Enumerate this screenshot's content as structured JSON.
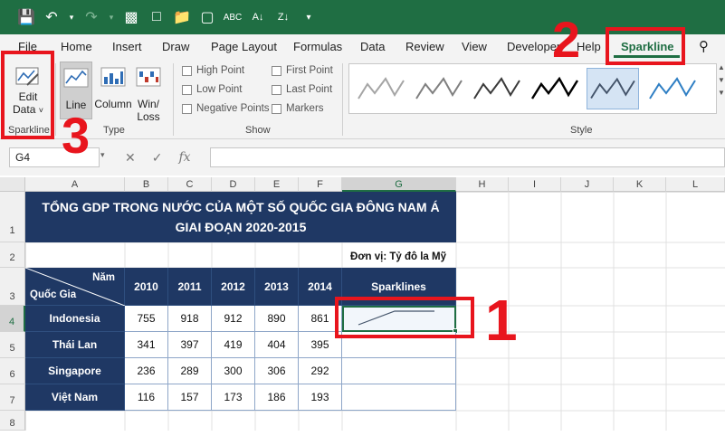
{
  "ribbon_tabs": [
    "File",
    "Home",
    "Insert",
    "Draw",
    "Page Layout",
    "Formulas",
    "Data",
    "Review",
    "View",
    "Developer",
    "Help",
    "Sparkline"
  ],
  "active_tab": "Sparkline",
  "groups": {
    "sparkline": {
      "label": "Sparkline",
      "edit_data": "Edit",
      "edit_data2": "Data"
    },
    "type": {
      "label": "Type",
      "line": "Line",
      "column": "Column",
      "winloss1": "Win/",
      "winloss2": "Loss"
    },
    "show": {
      "label": "Show",
      "items": [
        "High Point",
        "Low Point",
        "Negative Points",
        "First Point",
        "Last Point",
        "Markers"
      ]
    },
    "style": {
      "label": "Style"
    }
  },
  "formula_bar": {
    "name_box": "G4",
    "fx": "fx",
    "formula": ""
  },
  "columns": [
    "A",
    "B",
    "C",
    "D",
    "E",
    "F",
    "G",
    "H",
    "I",
    "J",
    "K",
    "L"
  ],
  "rows": [
    "1",
    "2",
    "3",
    "4",
    "5",
    "6",
    "7",
    "8"
  ],
  "sheet": {
    "title_line1": "TỔNG GDP TRONG NƯỚC CỦA MỘT SỐ QUỐC GIA ĐÔNG NAM Á",
    "title_line2": "GIAI ĐOẠN 2020-2015",
    "unit": "Đơn vị: Tỷ đô la Mỹ",
    "header_year": "Năm",
    "header_country": "Quốc Gia",
    "years": [
      "2010",
      "2011",
      "2012",
      "2013",
      "2014"
    ],
    "sparklines_header": "Sparklines",
    "data": [
      {
        "country": "Indonesia",
        "values": [
          "755",
          "918",
          "912",
          "890",
          "861"
        ]
      },
      {
        "country": "Thái Lan",
        "values": [
          "341",
          "397",
          "419",
          "404",
          "395"
        ]
      },
      {
        "country": "Singapore",
        "values": [
          "236",
          "289",
          "300",
          "306",
          "292"
        ]
      },
      {
        "country": "Việt Nam",
        "values": [
          "116",
          "157",
          "173",
          "186",
          "193"
        ]
      }
    ]
  },
  "annotations": {
    "one": "1",
    "two": "2",
    "three": "3"
  },
  "colors": {
    "ribbon_green": "#1f6e43",
    "table_navy": "#1f3864",
    "annotation_red": "#e8151d"
  }
}
